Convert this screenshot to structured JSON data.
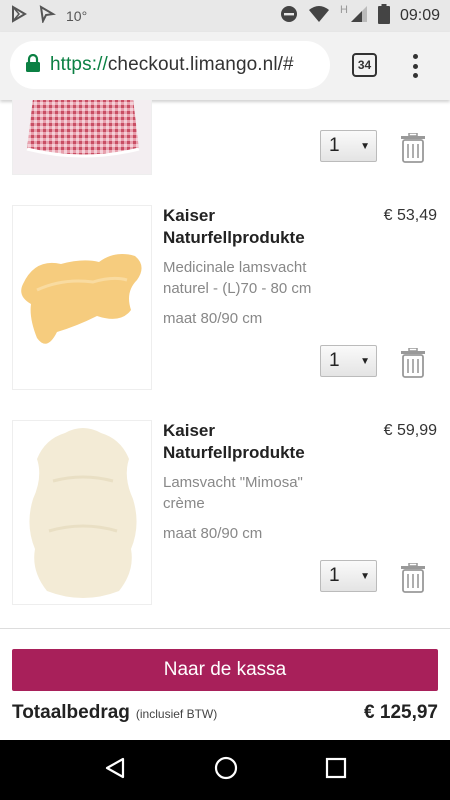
{
  "status_bar": {
    "temperature": "10°",
    "time": "09:09",
    "network_letter": "H"
  },
  "browser": {
    "url_scheme": "https://",
    "url_host": "checkout.limango.nl/#",
    "tab_count": "34"
  },
  "cart": {
    "items": [
      {
        "brand": "",
        "price": "",
        "description": "",
        "size": "",
        "quantity": "1"
      },
      {
        "brand": "Kaiser Naturfellprodukte",
        "price": "€ 53,49",
        "description": "Medicinale lamsvacht naturel - (L)70 - 80 cm",
        "size": "maat 80/90 cm",
        "quantity": "1"
      },
      {
        "brand": "Kaiser Naturfellprodukte",
        "price": "€ 59,99",
        "description": "Lamsvacht \"Mimosa\" crème",
        "size": "maat 80/90 cm",
        "quantity": "1"
      }
    ]
  },
  "footer": {
    "checkout_label": "Naar de kassa",
    "total_label": "Totaalbedrag",
    "total_note": "(inclusief BTW)",
    "total_value": "€ 125,97"
  },
  "colors": {
    "accent": "#a8205a",
    "url_scheme": "#0b8043"
  },
  "icons": [
    "play-store-icon",
    "navigation-icon",
    "do-not-disturb-icon",
    "wifi-icon",
    "signal-icon",
    "battery-icon",
    "lock-icon",
    "menu-dots-icon",
    "trash-icon",
    "back-icon",
    "home-icon",
    "recents-icon"
  ]
}
